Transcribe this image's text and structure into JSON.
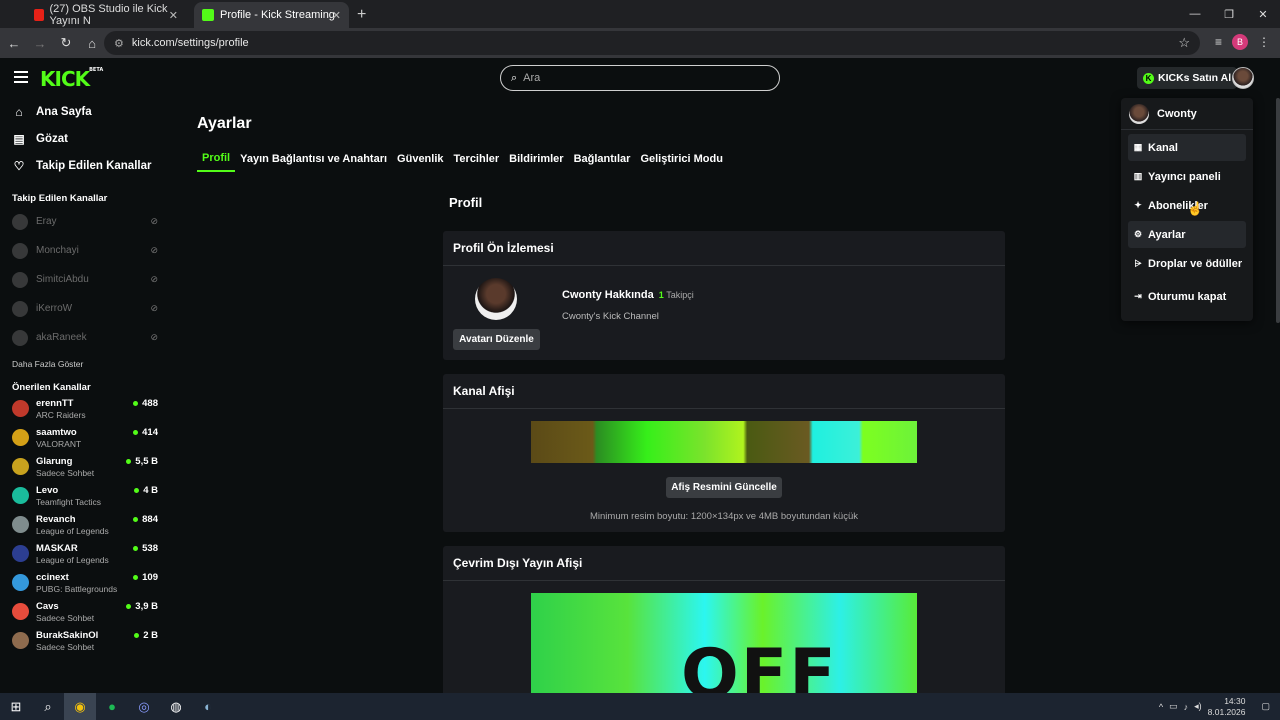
{
  "browser": {
    "tabs": [
      {
        "title": "(27) OBS Studio ile Kick Yayını N",
        "active": false
      },
      {
        "title": "Profile - Kick Streaming",
        "active": true
      }
    ],
    "url": "kick.com/settings/profile",
    "profile_initial": "B"
  },
  "header": {
    "logo": "KICK",
    "logo_badge": "BETA",
    "search_placeholder": "Ara",
    "buy_button": "KICKs Satın Al"
  },
  "sidebar": {
    "nav": [
      {
        "label": "Ana Sayfa",
        "icon": "home-icon"
      },
      {
        "label": "Gözat",
        "icon": "browse-icon"
      },
      {
        "label": "Takip Edilen Kanallar",
        "icon": "heart-icon"
      }
    ],
    "followed_heading": "Takip Edilen Kanallar",
    "followed": [
      {
        "name": "Eray"
      },
      {
        "name": "Monchayi"
      },
      {
        "name": "SimitciAbdu"
      },
      {
        "name": "iKerroW"
      },
      {
        "name": "akaRaneek"
      }
    ],
    "show_more": "Daha Fazla Göster",
    "recommended_heading": "Önerilen Kanallar",
    "recommended": [
      {
        "name": "erennTT",
        "category": "ARC Raiders",
        "viewers": "488",
        "color": "#c0392b"
      },
      {
        "name": "saamtwo",
        "category": "VALORANT",
        "viewers": "414",
        "color": "#d4a017"
      },
      {
        "name": "Glarung",
        "category": "Sadece Sohbet",
        "viewers": "5,5 B",
        "color": "#c8a21e"
      },
      {
        "name": "Levo",
        "category": "Teamfight Tactics",
        "viewers": "4 B",
        "color": "#1abc9c"
      },
      {
        "name": "Revanch",
        "category": "League of Legends",
        "viewers": "884",
        "color": "#7f8c8d"
      },
      {
        "name": "MASKAR",
        "category": "League of Legends",
        "viewers": "538",
        "color": "#2c3e91"
      },
      {
        "name": "ccinext",
        "category": "PUBG: Battlegrounds",
        "viewers": "109",
        "color": "#3498db"
      },
      {
        "name": "Cavs",
        "category": "Sadece Sohbet",
        "viewers": "3,9 B",
        "color": "#e74c3c"
      },
      {
        "name": "BurakSakinOl",
        "category": "Sadece Sohbet",
        "viewers": "2 B",
        "color": "#8e6b4e"
      }
    ]
  },
  "main": {
    "title": "Ayarlar",
    "tabs": [
      "Profil",
      "Yayın Bağlantısı ve Anahtarı",
      "Güvenlik",
      "Tercihler",
      "Bildirimler",
      "Bağlantılar",
      "Geliştirici Modu"
    ],
    "section": "Profil",
    "preview_card": {
      "title": "Profil Ön İzlemesi",
      "name": "Cwonty Hakkında",
      "followers": "1",
      "followers_label": "Takipçi",
      "description": "Cwonty's Kick Channel",
      "avatar_button": "Avatarı Düzenle"
    },
    "banner_card": {
      "title": "Kanal Afişi",
      "button": "Afiş Resmini Güncelle",
      "note": "Minimum resim boyutu: 1200×134px ve 4MB boyutundan küçük"
    },
    "offline_card": {
      "title": "Çevrim Dışı Yayın Afişi",
      "banner_text": "OFF_"
    }
  },
  "dropdown": {
    "username": "Cwonty",
    "items": [
      {
        "label": "Kanal",
        "icon": "channel-icon"
      },
      {
        "label": "Yayıncı paneli",
        "icon": "dashboard-icon"
      },
      {
        "label": "Abonelikler",
        "icon": "sparkle-icon"
      },
      {
        "label": "Ayarlar",
        "icon": "gear-icon"
      },
      {
        "label": "Droplar ve ödüller",
        "icon": "drops-icon"
      },
      {
        "label": "Oturumu kapat",
        "icon": "logout-icon"
      }
    ]
  },
  "taskbar": {
    "time": "14:30",
    "date": "8.01.2026"
  },
  "colors": {
    "accent": "#53fc18",
    "background": "#0b0e0f",
    "card": "#191b1f"
  }
}
